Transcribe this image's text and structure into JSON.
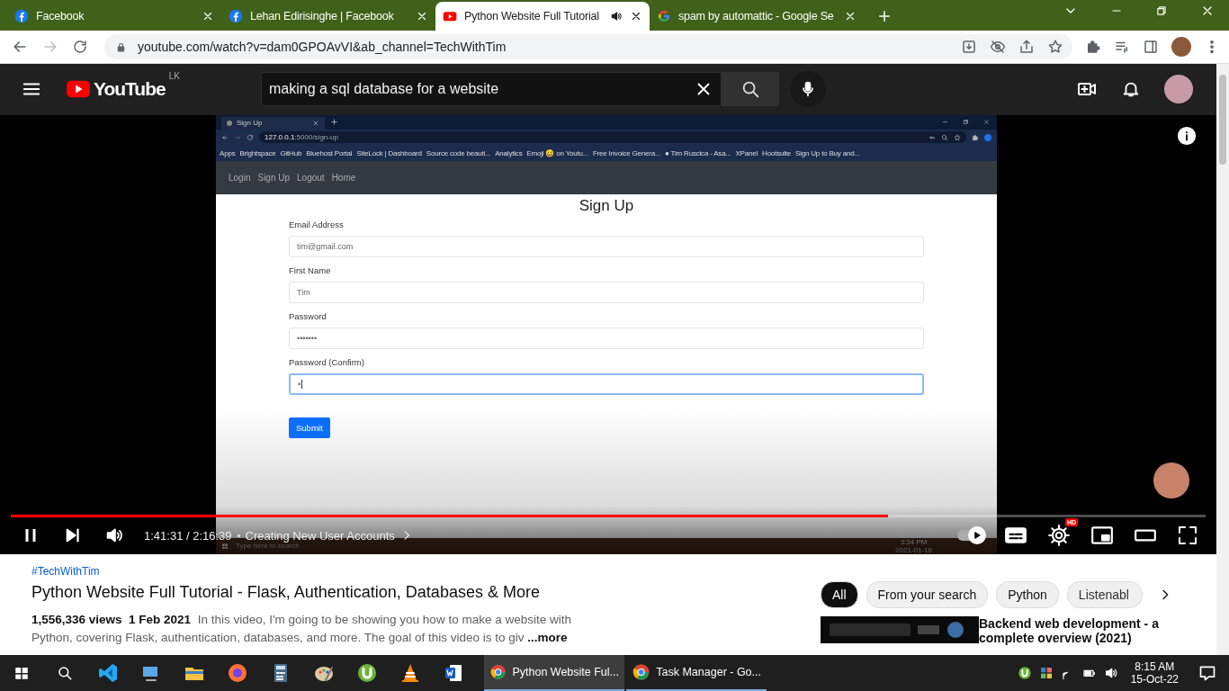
{
  "browser": {
    "tabs": [
      {
        "title": "Facebook",
        "kind": "facebook",
        "selected": false,
        "audio": false
      },
      {
        "title": "Lehan Edirisinghe | Facebook",
        "kind": "facebook",
        "selected": false,
        "audio": false
      },
      {
        "title": "Python Website Full Tutorial",
        "kind": "video",
        "selected": true,
        "audio": true
      },
      {
        "title": "spam by automattic - Google Se",
        "kind": "search",
        "selected": false,
        "audio": false
      }
    ],
    "url": "youtube.com/watch?v=dam0GPOAvVI&ab_channel=TechWithTim"
  },
  "youtube": {
    "logo": "YouTube",
    "country": "LK",
    "search": "making a sql database for a website"
  },
  "video": {
    "inner_browser": {
      "tab": "Sign Up",
      "url_host": "127.0.0.1",
      "url_path": ":5000/sign-up",
      "bookmarks": [
        "Apps",
        "Brightspace",
        "GitHub",
        "Bluehost Portal",
        "SiteLock | Dashboard",
        "Source code beauti...",
        "Analytics",
        "Emoji 😀 on Youtu...",
        "Free Invoice Genera...",
        "● Tim Ruscica - Asa...",
        "XPanel",
        "Hootsuite",
        "Sign Up to Buy and..."
      ],
      "nav": [
        "Login",
        "Sign Up",
        "Logout",
        "Home"
      ]
    },
    "form": {
      "heading": "Sign Up",
      "fields": [
        {
          "label": "Email Address",
          "value": "tim@gmail.com",
          "focused": false
        },
        {
          "label": "First Name",
          "value": "Tim",
          "focused": false
        },
        {
          "label": "Password",
          "value": "•••••••",
          "focused": false
        },
        {
          "label": "Password (Confirm)",
          "value": "•",
          "focused": true
        }
      ],
      "submit": "Submit"
    },
    "taskbar_search": "Type here to search",
    "clock_time": "3:34 PM",
    "clock_date": "2021-01-16"
  },
  "player": {
    "progress": {
      "level": 0.734
    },
    "playing": true,
    "time": "1:41:31 / 2:16:39",
    "chapter": "Creating New User Accounts",
    "autoplay": true,
    "quality_badge": "HD"
  },
  "details": {
    "hashtag": "#TechWithTim",
    "title": "Python Website Full Tutorial - Flask, Authentication, Databases & More",
    "views": "1,556,336 views",
    "date": "1 Feb 2021",
    "description": "In this video, I'm going to be showing you how to make a website with Python, covering Flask, authentication, databases, and more. The goal of this video is to giv",
    "more": "...more"
  },
  "chips": [
    {
      "label": "All",
      "selected": true
    },
    {
      "label": "From your search",
      "selected": false
    },
    {
      "label": "Python",
      "selected": false
    },
    {
      "label": "Listenabl",
      "selected": false
    }
  ],
  "recommended": {
    "title": "Backend web development - a complete overview (2021)"
  },
  "taskbar": {
    "tasks": [
      {
        "label": "Python Website Ful...",
        "selected": true
      },
      {
        "label": "Task Manager - Go...",
        "selected": false
      }
    ],
    "time": "8:15 AM",
    "date": "15-Oct-22"
  }
}
